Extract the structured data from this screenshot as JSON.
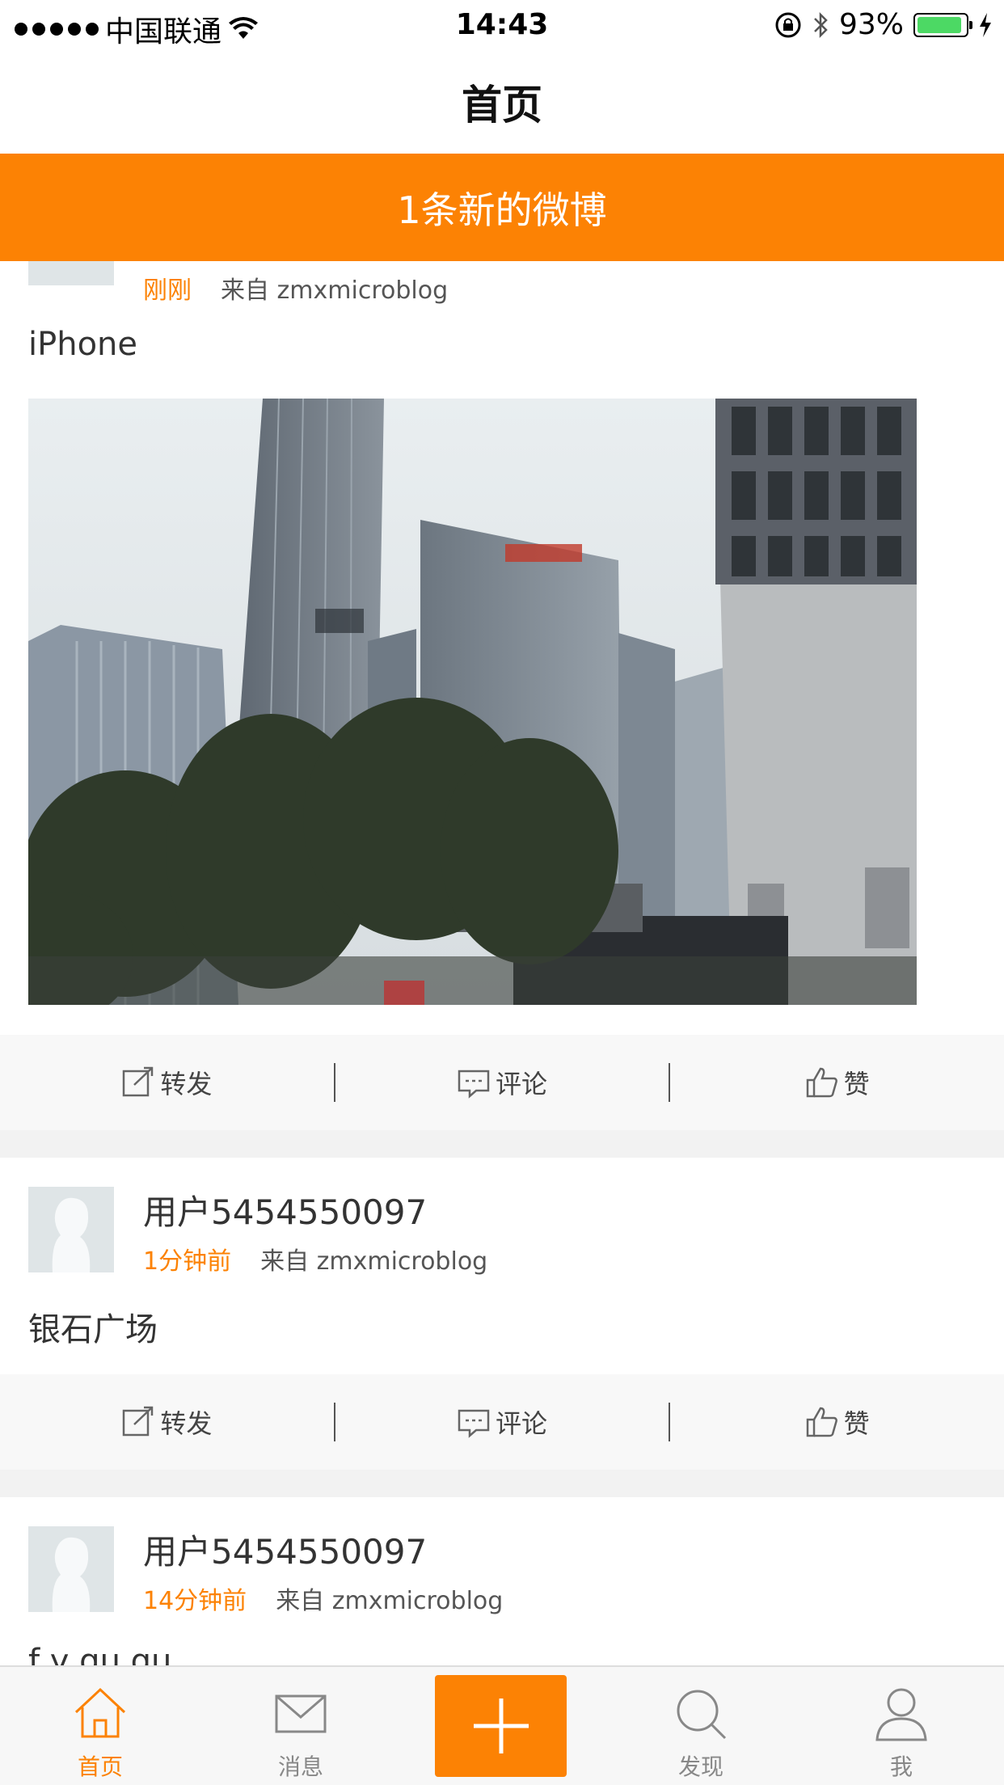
{
  "status_bar": {
    "carrier": "中国联通",
    "time": "14:43",
    "battery": "93%",
    "battery_level": 0.93
  },
  "nav": {
    "title": "首页"
  },
  "banner": {
    "text": "1条新的微博"
  },
  "posts": [
    {
      "username": "",
      "time": "刚刚",
      "source": "来自 zmxmicroblog",
      "text": "iPhone",
      "has_photo": true,
      "actions": {
        "repost": "转发",
        "comment": "评论",
        "like": "赞"
      }
    },
    {
      "username": "用户5454550097",
      "time": "1分钟前",
      "source": "来自 zmxmicroblog",
      "text": "银石广场",
      "has_photo": false,
      "actions": {
        "repost": "转发",
        "comment": "评论",
        "like": "赞"
      }
    },
    {
      "username": "用户5454550097",
      "time": "14分钟前",
      "source": "来自 zmxmicroblog",
      "text": "f y gu gu",
      "has_photo": false
    }
  ],
  "tab_bar": {
    "home": "首页",
    "messages": "消息",
    "discover": "发现",
    "me": "我",
    "accent": "#fc8204"
  }
}
